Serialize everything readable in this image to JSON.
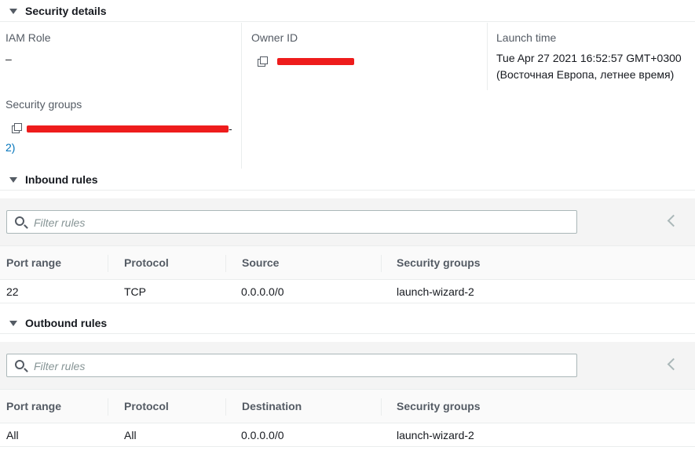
{
  "security_details": {
    "title": "Security details",
    "iam_role": {
      "label": "IAM Role",
      "value": "–"
    },
    "owner_id": {
      "label": "Owner ID"
    },
    "launch_time": {
      "label": "Launch time",
      "line1": "Tue Apr 27 2021 16:52:57 GMT+0300",
      "line2": "(Восточная Европа, летнее время)"
    },
    "security_groups": {
      "label": "Security groups",
      "value_tail_1": "-",
      "value_tail_2": "2)"
    }
  },
  "inbound_rules": {
    "title": "Inbound rules",
    "filter_placeholder": "Filter rules",
    "columns": [
      "Port range",
      "Protocol",
      "Source",
      "Security groups"
    ],
    "rows": [
      {
        "port_range": "22",
        "protocol": "TCP",
        "source": "0.0.0.0/0",
        "security_groups": "launch-wizard-2"
      }
    ]
  },
  "outbound_rules": {
    "title": "Outbound rules",
    "filter_placeholder": "Filter rules",
    "columns": [
      "Port range",
      "Protocol",
      "Destination",
      "Security groups"
    ],
    "rows": [
      {
        "port_range": "All",
        "protocol": "All",
        "destination": "0.0.0.0/0",
        "security_groups": "launch-wizard-2"
      }
    ]
  },
  "colors": {
    "redaction": "#ee1c1c",
    "link": "#0073bb",
    "label": "#545b64"
  },
  "icons": [
    "caret-down-icon",
    "copy-icon",
    "search-icon",
    "chevron-left-icon"
  ]
}
